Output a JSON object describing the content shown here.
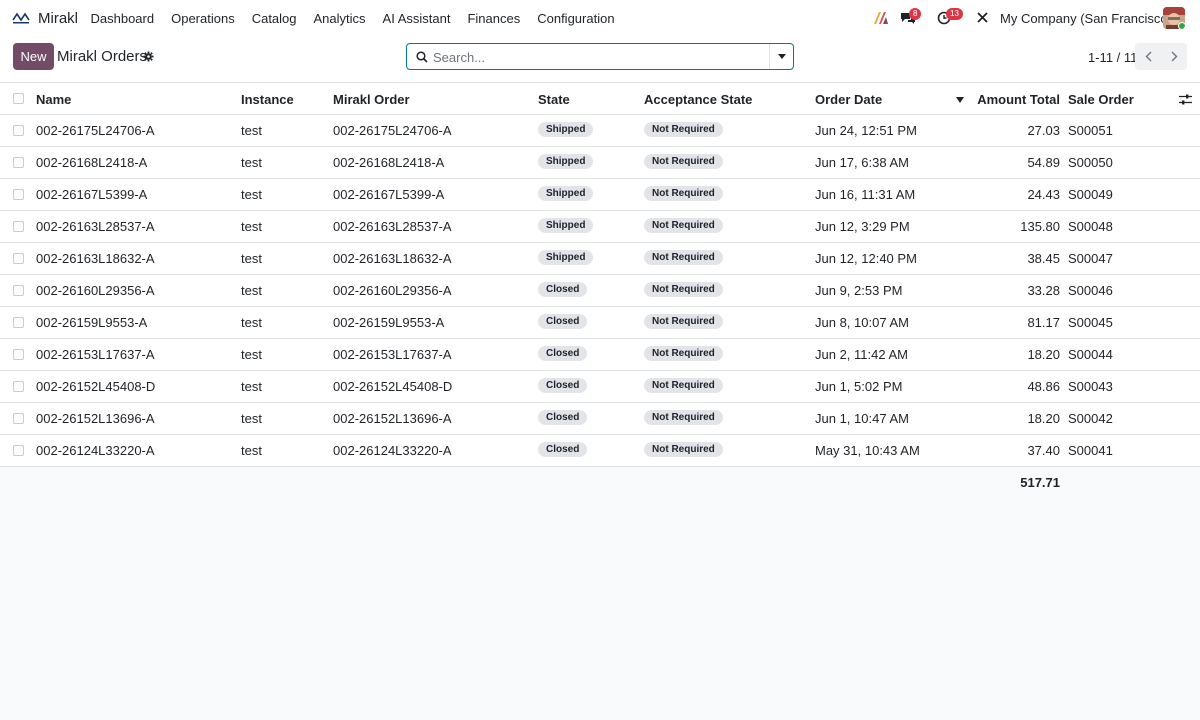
{
  "app": {
    "name": "Mirakl",
    "logo_icon": "mirakl-logo-icon"
  },
  "nav": [
    "Dashboard",
    "Operations",
    "Catalog",
    "Analytics",
    "AI Assistant",
    "Finances",
    "Configuration"
  ],
  "systray": {
    "messages_count": "8",
    "activities_count": "13",
    "company": "My Company (San Francisco)"
  },
  "control": {
    "new_label": "New",
    "title": "Mirakl Orders",
    "search_placeholder": "Search...",
    "pager": "1-11 / 11"
  },
  "columns": {
    "name": "Name",
    "instance": "Instance",
    "mirakl_order": "Mirakl Order",
    "state": "State",
    "acceptance_state": "Acceptance State",
    "order_date": "Order Date",
    "amount_total": "Amount Total",
    "sale_order": "Sale Order"
  },
  "rows": [
    {
      "name": "002-26175L24706-A",
      "instance": "test",
      "mirakl_order": "002-26175L24706-A",
      "state": "Shipped",
      "acceptance": "Not Required",
      "date": "Jun 24, 12:51 PM",
      "amount": "27.03",
      "sale": "S00051"
    },
    {
      "name": "002-26168L2418-A",
      "instance": "test",
      "mirakl_order": "002-26168L2418-A",
      "state": "Shipped",
      "acceptance": "Not Required",
      "date": "Jun 17, 6:38 AM",
      "amount": "54.89",
      "sale": "S00050"
    },
    {
      "name": "002-26167L5399-A",
      "instance": "test",
      "mirakl_order": "002-26167L5399-A",
      "state": "Shipped",
      "acceptance": "Not Required",
      "date": "Jun 16, 11:31 AM",
      "amount": "24.43",
      "sale": "S00049"
    },
    {
      "name": "002-26163L28537-A",
      "instance": "test",
      "mirakl_order": "002-26163L28537-A",
      "state": "Shipped",
      "acceptance": "Not Required",
      "date": "Jun 12, 3:29 PM",
      "amount": "135.80",
      "sale": "S00048"
    },
    {
      "name": "002-26163L18632-A",
      "instance": "test",
      "mirakl_order": "002-26163L18632-A",
      "state": "Shipped",
      "acceptance": "Not Required",
      "date": "Jun 12, 12:40 PM",
      "amount": "38.45",
      "sale": "S00047"
    },
    {
      "name": "002-26160L29356-A",
      "instance": "test",
      "mirakl_order": "002-26160L29356-A",
      "state": "Closed",
      "acceptance": "Not Required",
      "date": "Jun 9, 2:53 PM",
      "amount": "33.28",
      "sale": "S00046"
    },
    {
      "name": "002-26159L9553-A",
      "instance": "test",
      "mirakl_order": "002-26159L9553-A",
      "state": "Closed",
      "acceptance": "Not Required",
      "date": "Jun 8, 10:07 AM",
      "amount": "81.17",
      "sale": "S00045"
    },
    {
      "name": "002-26153L17637-A",
      "instance": "test",
      "mirakl_order": "002-26153L17637-A",
      "state": "Closed",
      "acceptance": "Not Required",
      "date": "Jun 2, 11:42 AM",
      "amount": "18.20",
      "sale": "S00044"
    },
    {
      "name": "002-26152L45408-D",
      "instance": "test",
      "mirakl_order": "002-26152L45408-D",
      "state": "Closed",
      "acceptance": "Not Required",
      "date": "Jun 1, 5:02 PM",
      "amount": "48.86",
      "sale": "S00043"
    },
    {
      "name": "002-26152L13696-A",
      "instance": "test",
      "mirakl_order": "002-26152L13696-A",
      "state": "Closed",
      "acceptance": "Not Required",
      "date": "Jun 1, 10:47 AM",
      "amount": "18.20",
      "sale": "S00042"
    },
    {
      "name": "002-26124L33220-A",
      "instance": "test",
      "mirakl_order": "002-26124L33220-A",
      "state": "Closed",
      "acceptance": "Not Required",
      "date": "May 31, 10:43 AM",
      "amount": "37.40",
      "sale": "S00041"
    }
  ],
  "total": "517.71",
  "colors": {
    "primary": "#714b67",
    "search_border": "#017e84",
    "badge": "#dc3545",
    "pill_bg": "#e2e4e8"
  }
}
